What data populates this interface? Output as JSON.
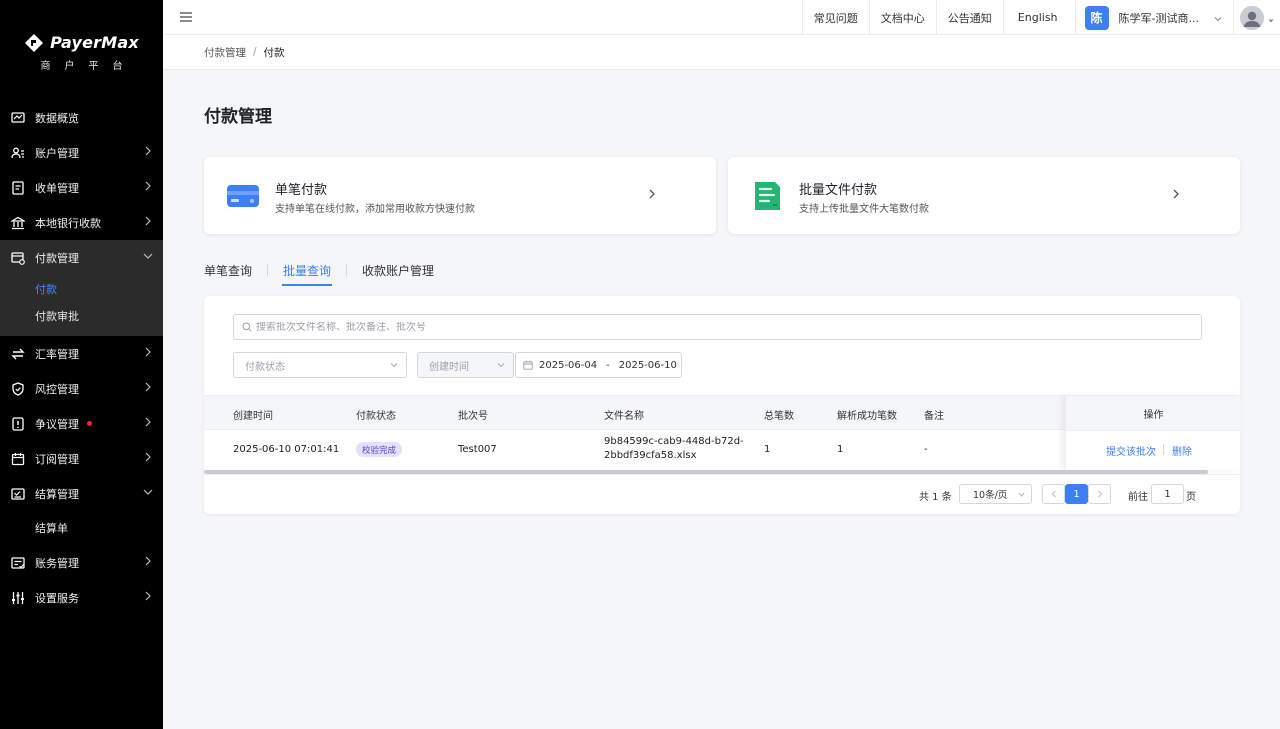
{
  "logo": {
    "brand": "PayerMax",
    "subtitle": "商户平台"
  },
  "sidebar": {
    "items": [
      {
        "label": "数据概览",
        "icon": "chart-icon"
      },
      {
        "label": "账户管理",
        "icon": "account-icon"
      },
      {
        "label": "收单管理",
        "icon": "receipt-icon"
      },
      {
        "label": "本地银行收款",
        "icon": "bank-icon"
      },
      {
        "label": "付款管理",
        "icon": "payment-icon",
        "open": true,
        "children": [
          "付款",
          "付款审批"
        ],
        "active_child": "付款"
      },
      {
        "label": "汇率管理",
        "icon": "exchange-icon"
      },
      {
        "label": "风控管理",
        "icon": "shield-icon"
      },
      {
        "label": "争议管理",
        "icon": "dispute-icon",
        "has_dot": true
      },
      {
        "label": "订阅管理",
        "icon": "calendar-icon"
      },
      {
        "label": "结算管理",
        "icon": "settlement-icon",
        "open": true,
        "children": [
          "结算单"
        ]
      },
      {
        "label": "账务管理",
        "icon": "ledger-icon"
      },
      {
        "label": "设置服务",
        "icon": "settings-icon"
      }
    ]
  },
  "topbar": {
    "links": [
      "常见问题",
      "文档中心",
      "公告通知",
      "English"
    ],
    "user_initial": "陈",
    "user_name": "陈学军-测试商..."
  },
  "breadcrumb": {
    "first": "付款管理",
    "separator": "/",
    "current": "付款"
  },
  "page_title": "付款管理",
  "cards": [
    {
      "title": "单笔付款",
      "desc": "支持单笔在线付款，添加常用收款方快速付款",
      "icon": "card-payment-icon",
      "color": "#3d7ff5"
    },
    {
      "title": "批量文件付款",
      "desc": "支持上传批量文件大笔数付款",
      "icon": "batch-file-icon",
      "color": "#22b573"
    }
  ],
  "tabs": [
    {
      "label": "单笔查询",
      "active": false
    },
    {
      "label": "批量查询",
      "active": true
    },
    {
      "label": "收款账户管理",
      "active": false
    }
  ],
  "filters": {
    "search_placeholder": "搜索批次文件名称、批次备注、批次号",
    "status_placeholder": "付款状态",
    "time_type": "创建时间",
    "date_start": "2025-06-04",
    "date_sep": "-",
    "date_end": "2025-06-10"
  },
  "table": {
    "columns": [
      "创建时间",
      "付款状态",
      "批次号",
      "文件名称",
      "总笔数",
      "解析成功笔数",
      "备注",
      "操作"
    ],
    "rows": [
      {
        "created": "2025-06-10 07:01:41",
        "status": "校验完成",
        "batch_no": "Test007",
        "file_line1": "9b84599c-cab9-448d-b72d-",
        "file_line2": "2bbdf39cfa58.xlsx",
        "total": "1",
        "parsed": "1",
        "remark": "-",
        "op_submit": "提交该批次",
        "op_delete": "删除"
      }
    ]
  },
  "pagination": {
    "total_text": "共 1 条",
    "page_size": "10条/页",
    "current_page": "1",
    "goto_label": "前往",
    "goto_value": "1",
    "page_suffix": "页"
  },
  "colors": {
    "accent": "#3d7ff5",
    "sidebar_bg": "#000000",
    "badge_bg": "#e5e0fb",
    "badge_text": "#5a43c9"
  }
}
